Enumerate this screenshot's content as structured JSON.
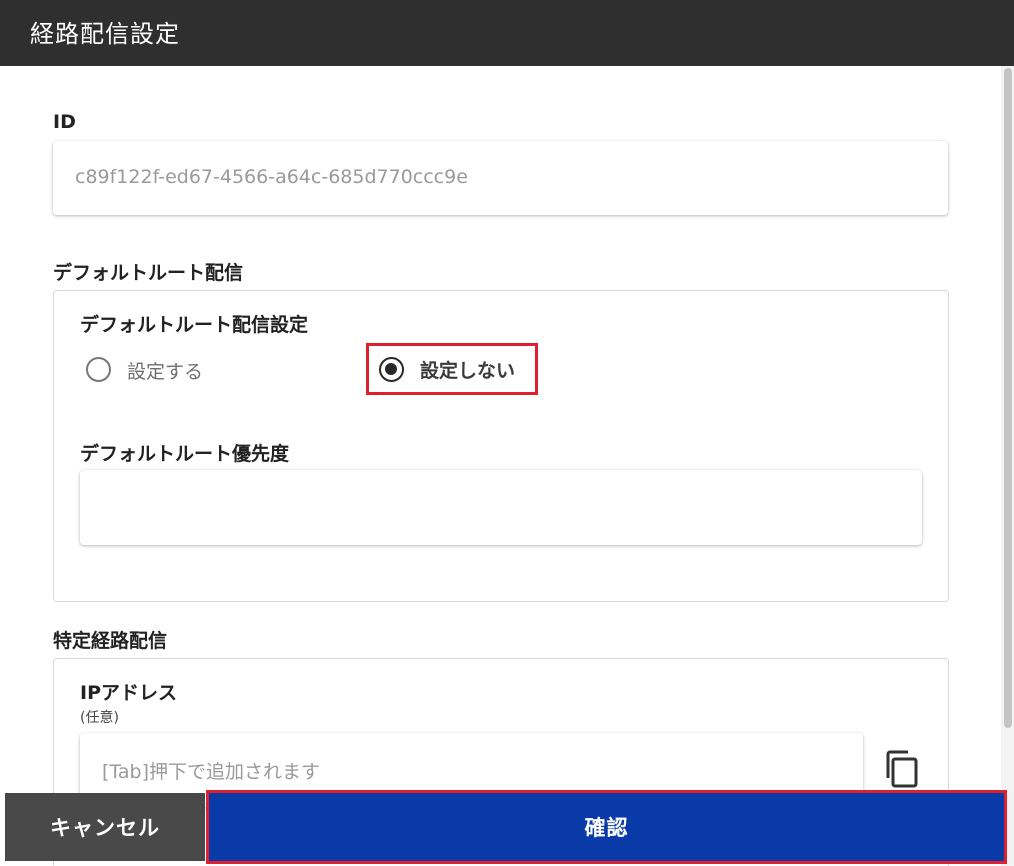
{
  "dialog": {
    "title": "経路配信設定"
  },
  "id_section": {
    "label": "ID",
    "value": "c89f122f-ed67-4566-a64c-685d770ccc9e"
  },
  "default_route": {
    "section_label": "デフォルトルート配信",
    "setting_label": "デフォルトルート配信設定",
    "options": [
      {
        "label": "設定する",
        "selected": false
      },
      {
        "label": "設定しない",
        "selected": true
      }
    ],
    "priority_label": "デフォルトルート優先度",
    "priority_value": ""
  },
  "specific_route": {
    "section_label": "特定経路配信",
    "ip_label": "IPアドレス",
    "ip_optional": "(任意)",
    "ip_placeholder": "[Tab]押下で追加されます",
    "copy_icon": "copy-icon"
  },
  "footer": {
    "cancel_label": "キャンセル",
    "confirm_label": "確認"
  },
  "colors": {
    "header_bg": "#2f2f2f",
    "confirm_bg": "#0a3aa8",
    "cancel_bg": "#494949",
    "highlight": "#e0202f"
  }
}
